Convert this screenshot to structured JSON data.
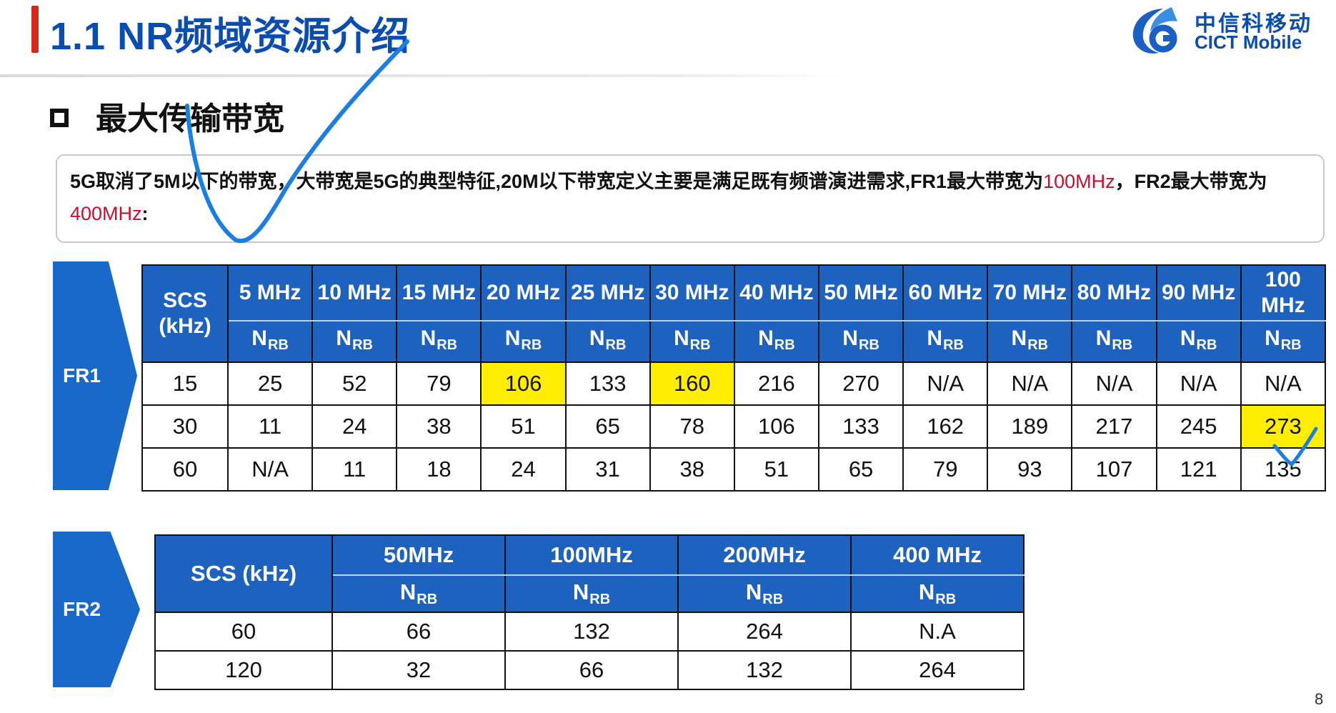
{
  "header": {
    "title": "1.1 NR频域资源介绍"
  },
  "logo": {
    "cn": "中信科移动",
    "en": "CICT Mobile"
  },
  "section": {
    "title": "最大传输带宽"
  },
  "note": {
    "line1": "5G取消了5M以下的带宽，大带宽是5G的典型特征,20M以下带宽定义主要是满足既有频谱演进需求,FR1最大带宽为",
    "fr1_max": "100MHz",
    "mid": "，FR2最大带宽为",
    "fr2_max": "400MHz",
    "end": ":"
  },
  "fr1": {
    "label": "FR1",
    "scs_header": "SCS (kHz)",
    "nrb_main": "N",
    "nrb_sub": "RB",
    "bandwidths": [
      "5 MHz",
      "10 MHz",
      "15 MHz",
      "20 MHz",
      "25 MHz",
      "30 MHz",
      "40 MHz",
      "50 MHz",
      "60 MHz",
      "70 MHz",
      "80 MHz",
      "90 MHz",
      "100 MHz"
    ],
    "rows": [
      {
        "scs": "15",
        "values": [
          "25",
          "52",
          "79",
          "106",
          "133",
          "160",
          "216",
          "270",
          "N/A",
          "N/A",
          "N/A",
          "N/A",
          "N/A"
        ],
        "highlight": [
          3,
          5
        ]
      },
      {
        "scs": "30",
        "values": [
          "11",
          "24",
          "38",
          "51",
          "65",
          "78",
          "106",
          "133",
          "162",
          "189",
          "217",
          "245",
          "273"
        ],
        "highlight": [
          12
        ]
      },
      {
        "scs": "60",
        "values": [
          "N/A",
          "11",
          "18",
          "24",
          "31",
          "38",
          "51",
          "65",
          "79",
          "93",
          "107",
          "121",
          "135"
        ],
        "highlight": []
      }
    ]
  },
  "fr2": {
    "label": "FR2",
    "scs_header": "SCS (kHz)",
    "nrb_main": "N",
    "nrb_sub": "RB",
    "bandwidths": [
      "50MHz",
      "100MHz",
      "200MHz",
      "400 MHz"
    ],
    "rows": [
      {
        "scs": "60",
        "values": [
          "66",
          "132",
          "264",
          "N.A"
        ]
      },
      {
        "scs": "120",
        "values": [
          "32",
          "66",
          "132",
          "264"
        ]
      }
    ]
  },
  "page": {
    "number": "8"
  },
  "colors": {
    "title_blue": "#0a4db0",
    "header_blue": "#1e62c0",
    "arrow_blue": "#1869c9",
    "accent_red": "#c8102e",
    "highlight": "#ffee00",
    "pen_blue": "#1a7fe0"
  }
}
